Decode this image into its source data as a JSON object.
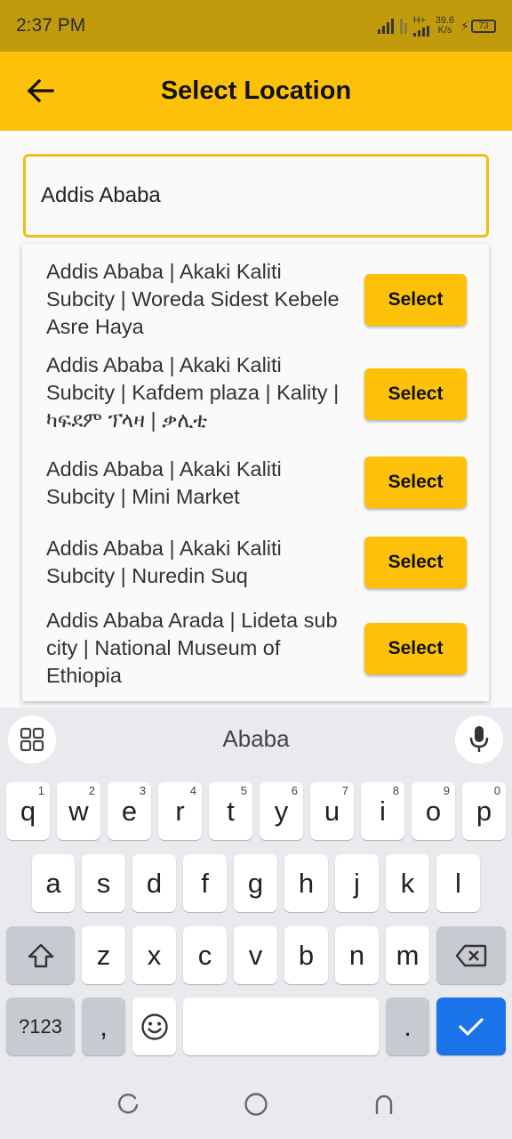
{
  "status_bar": {
    "time": "2:37 PM",
    "network_type": "H+",
    "data_speed_value": "39.6",
    "data_speed_unit": "K/s",
    "battery": "73"
  },
  "app_bar": {
    "title": "Select Location",
    "back_icon": "arrow-left-icon"
  },
  "search": {
    "value": "Addis Ababa"
  },
  "results": [
    {
      "text": "Addis Ababa | Akaki Kaliti Subcity | Woreda Sidest Kebele Asre Haya",
      "button": "Select"
    },
    {
      "text": "Addis Ababa | Akaki Kaliti Subcity | Kafdem plaza | Kality | ካፍደም ፕላዛ | ቃሊቲ",
      "button": "Select"
    },
    {
      "text": "Addis Ababa | Akaki Kaliti Subcity | Mini Market",
      "button": "Select"
    },
    {
      "text": "Addis Ababa | Akaki Kaliti Subcity | Nuredin Suq",
      "button": "Select"
    },
    {
      "text": "Addis Ababa Arada | Lideta sub city | National Museum of Ethiopia",
      "button": "Select"
    }
  ],
  "keyboard": {
    "suggestion": "Ababa",
    "row1": [
      {
        "key": "q",
        "hint": "1"
      },
      {
        "key": "w",
        "hint": "2"
      },
      {
        "key": "e",
        "hint": "3"
      },
      {
        "key": "r",
        "hint": "4"
      },
      {
        "key": "t",
        "hint": "5"
      },
      {
        "key": "y",
        "hint": "6"
      },
      {
        "key": "u",
        "hint": "7"
      },
      {
        "key": "i",
        "hint": "8"
      },
      {
        "key": "o",
        "hint": "9"
      },
      {
        "key": "p",
        "hint": "0"
      }
    ],
    "row2": [
      "a",
      "s",
      "d",
      "f",
      "g",
      "h",
      "j",
      "k",
      "l"
    ],
    "row3": [
      "z",
      "x",
      "c",
      "v",
      "b",
      "n",
      "m"
    ],
    "symbols_label": "?123",
    "comma": ",",
    "period": "."
  },
  "colors": {
    "status_bar": "#c29b0c",
    "accent": "#fdc10a",
    "search_border": "#f2bd17",
    "enter_key": "#1a73e8"
  }
}
